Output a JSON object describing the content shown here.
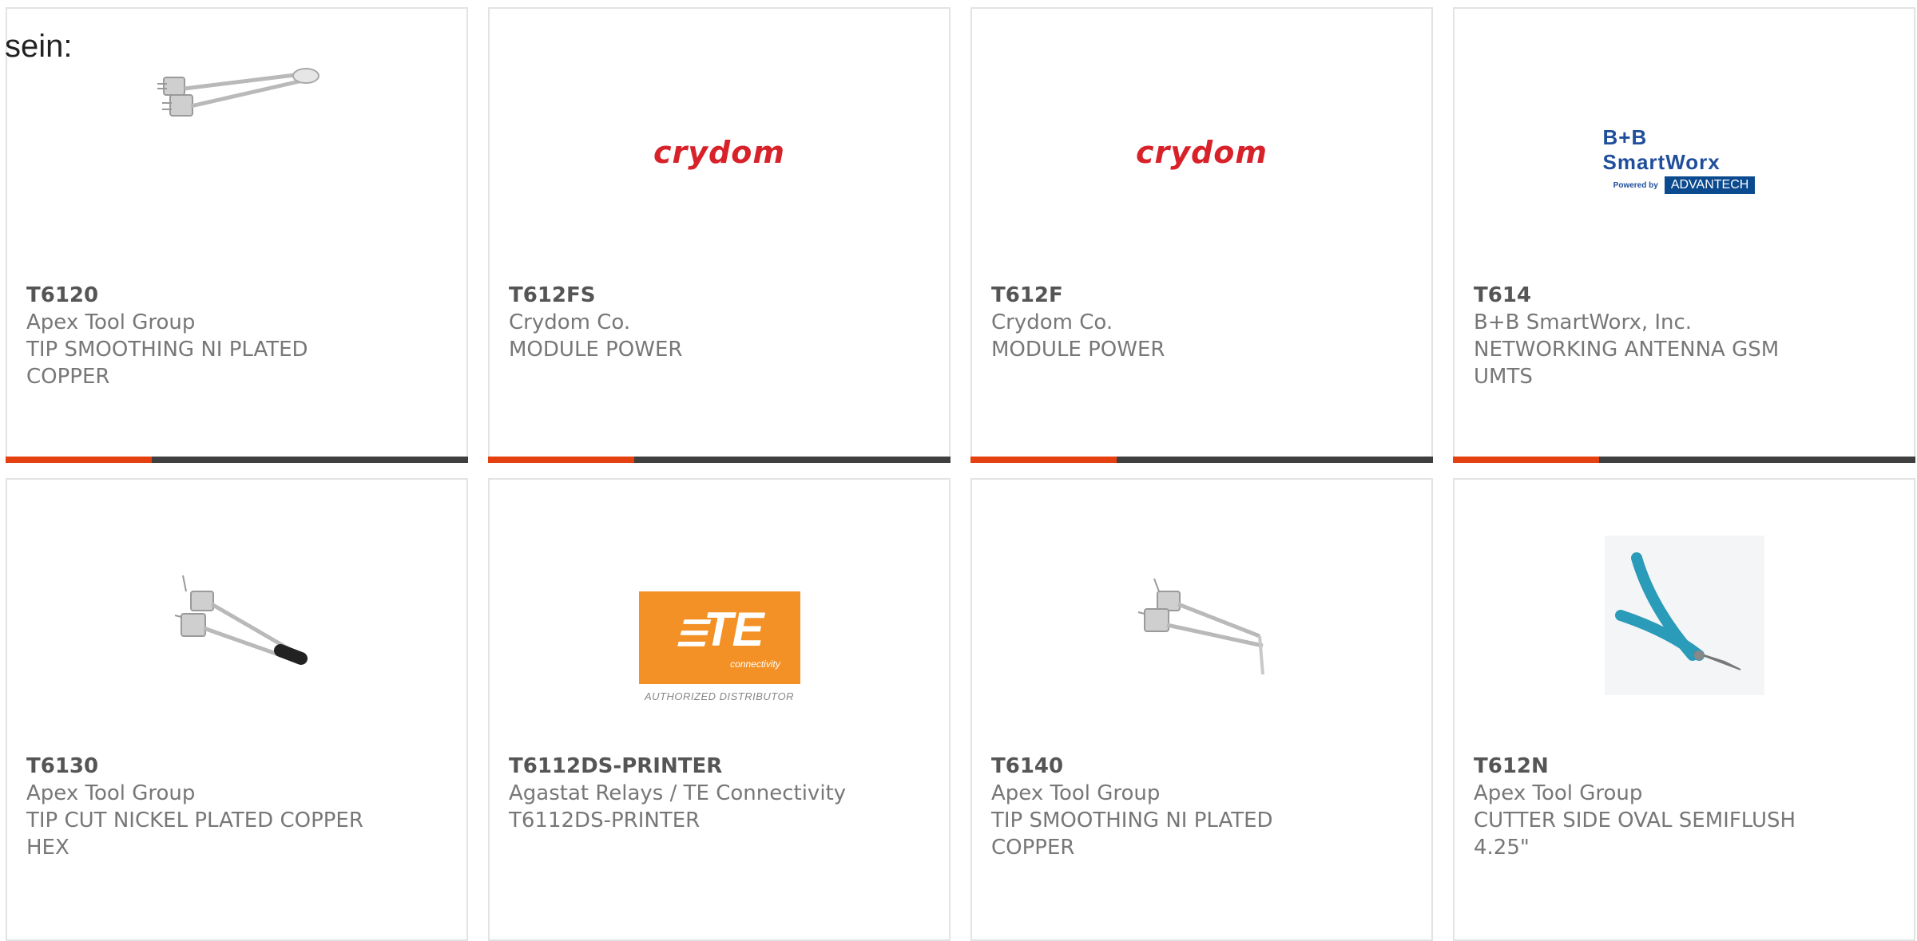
{
  "lead_text": "sein:",
  "products": [
    {
      "part": "T6120",
      "manufacturer": "Apex Tool Group",
      "description": "TIP SMOOTHING NI PLATED COPPER",
      "image": "soldering-tip-smoothing-photo"
    },
    {
      "part": "T612FS",
      "manufacturer": "Crydom Co.",
      "description": "MODULE POWER",
      "image": "crydom-logo",
      "logo_text": "crydom"
    },
    {
      "part": "T612F",
      "manufacturer": "Crydom Co.",
      "description": "MODULE POWER",
      "image": "crydom-logo",
      "logo_text": "crydom"
    },
    {
      "part": "T614",
      "manufacturer": "B+B SmartWorx, Inc.",
      "description": "NETWORKING ANTENNA GSM UMTS",
      "image": "bb-smartworx-logo",
      "logo_text": "B+B SmartWorx",
      "logo_sub_1": "Powered by",
      "logo_sub_2": "ADVANTECH"
    },
    {
      "part": "T6130",
      "manufacturer": "Apex Tool Group",
      "description": "TIP CUT NICKEL PLATED COPPER HEX",
      "image": "soldering-tip-cut-photo"
    },
    {
      "part": "T6112DS-PRINTER",
      "manufacturer": "Agastat Relays / TE Connectivity",
      "description": "T6112DS-PRINTER",
      "image": "te-connectivity-logo",
      "logo_text": "TE",
      "logo_sub_1": "connectivity",
      "logo_sub_2": "AUTHORIZED DISTRIBUTOR"
    },
    {
      "part": "T6140",
      "manufacturer": "Apex Tool Group",
      "description": "TIP SMOOTHING NI PLATED COPPER",
      "image": "soldering-tip-smoothing-photo"
    },
    {
      "part": "T612N",
      "manufacturer": "Apex Tool Group",
      "description": "CUTTER SIDE OVAL SEMIFLUSH 4.25\"",
      "image": "side-cutter-photo"
    }
  ],
  "colors": {
    "accent": "#e5400f",
    "bar_dark": "#3f3f3f",
    "crydom_red": "#d8222a",
    "te_orange": "#f39126",
    "bb_blue": "#1f4e9b",
    "cutter_teal": "#2a9bb8"
  }
}
